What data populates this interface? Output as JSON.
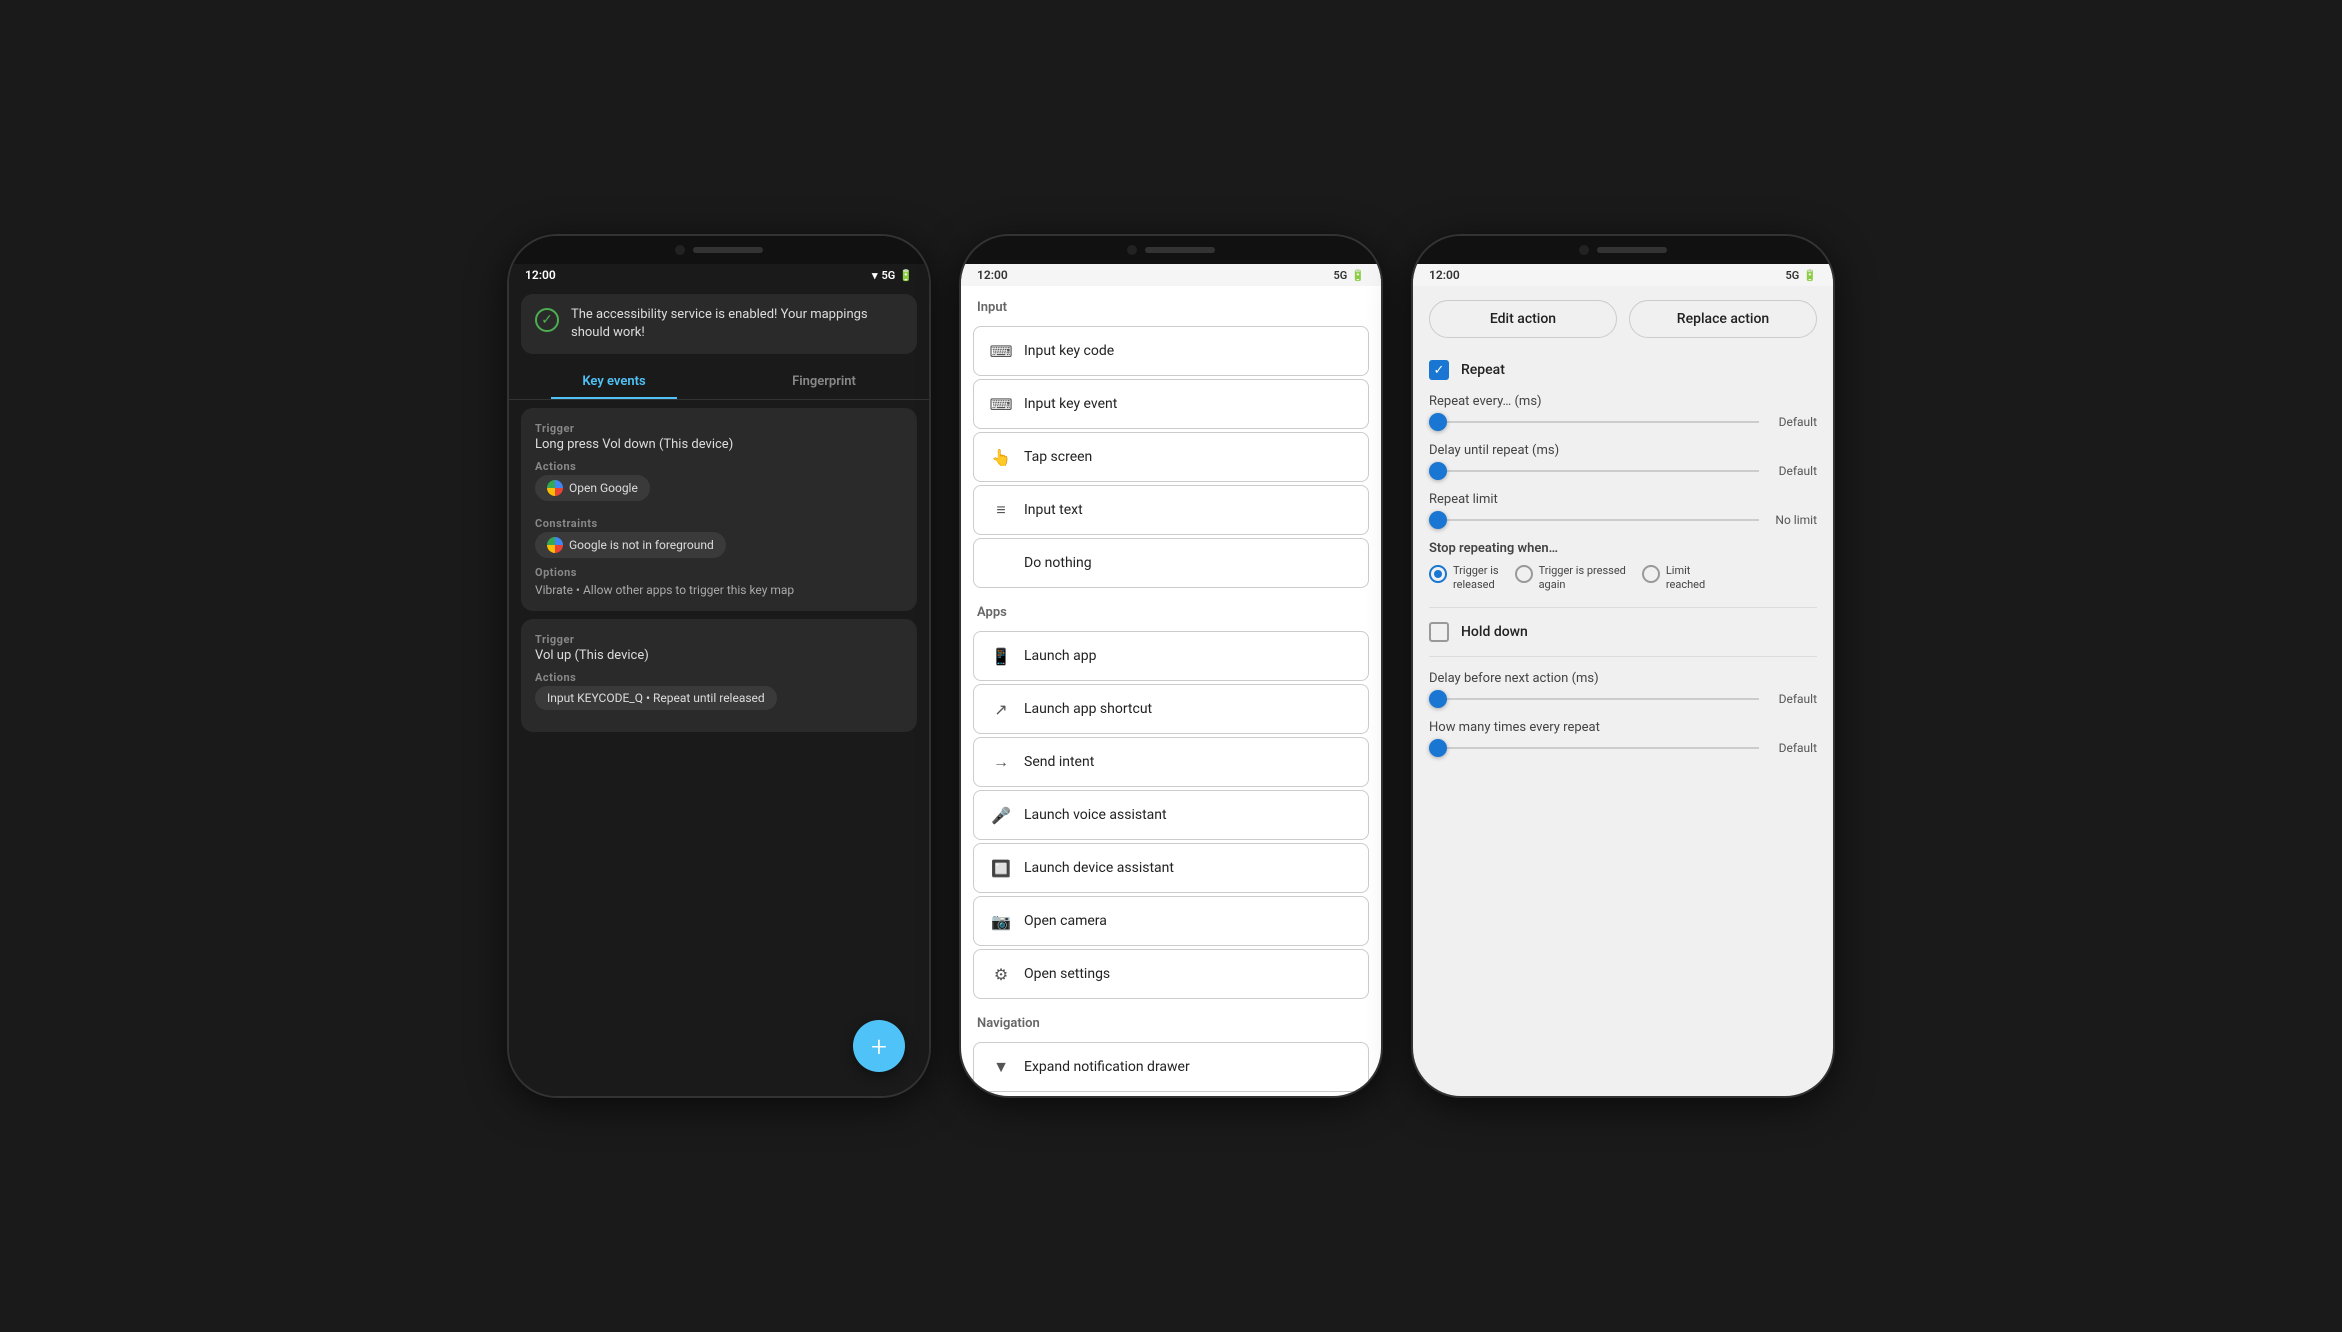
{
  "phone1": {
    "status": {
      "time": "12:00",
      "signal": "5G",
      "battery": "▐"
    },
    "notification": {
      "text": "The accessibility service is enabled! Your mappings should work!"
    },
    "tabs": [
      "Key events",
      "Fingerprint"
    ],
    "active_tab": 0,
    "mappings": [
      {
        "trigger_label": "Trigger",
        "trigger_value": "Long press Vol down (This device)",
        "actions_label": "Actions",
        "action_chip": "Open Google",
        "constraints_label": "Constraints",
        "constraint_chip": "Google is not in foreground",
        "options_label": "Options",
        "options_value": "Vibrate • Allow other apps to trigger this key map"
      },
      {
        "trigger_label": "Trigger",
        "trigger_value": "Vol up (This device)",
        "actions_label": "Actions",
        "action_chip": "Input KEYCODE_Q • Repeat until released",
        "constraints_label": null,
        "constraint_chip": null,
        "options_label": null,
        "options_value": null
      }
    ],
    "fab_label": "+"
  },
  "phone2": {
    "status": {
      "time": "12:00",
      "signal": "5G",
      "battery": "▐"
    },
    "section_input": "Input",
    "input_items": [
      {
        "icon": "⓪",
        "label": "Input key code"
      },
      {
        "icon": "⓪",
        "label": "Input key event"
      },
      {
        "icon": "✋",
        "label": "Tap screen"
      },
      {
        "icon": "≡",
        "label": "Input text"
      },
      {
        "icon": "",
        "label": "Do nothing"
      }
    ],
    "section_apps": "Apps",
    "app_items": [
      {
        "icon": "🤖",
        "label": "Launch app"
      },
      {
        "icon": "↗",
        "label": "Launch app shortcut"
      },
      {
        "icon": "→",
        "label": "Send intent"
      },
      {
        "icon": "⬆",
        "label": "Launch voice assistant"
      },
      {
        "icon": "⬆",
        "label": "Launch device assistant"
      },
      {
        "icon": "📷",
        "label": "Open camera"
      },
      {
        "icon": "⚙",
        "label": "Open settings"
      }
    ],
    "section_navigation": "Navigation",
    "nav_items": [
      {
        "icon": "▼",
        "label": "Expand notification drawer"
      }
    ]
  },
  "phone3": {
    "status": {
      "time": "12:00",
      "signal": "5G",
      "battery": "▐"
    },
    "edit_action_label": "Edit action",
    "replace_action_label": "Replace action",
    "repeat_label": "Repeat",
    "repeat_checked": true,
    "repeat_every_label": "Repeat every… (ms)",
    "repeat_every_value": "Default",
    "delay_until_label": "Delay until repeat (ms)",
    "delay_until_value": "Default",
    "repeat_limit_label": "Repeat limit",
    "repeat_limit_value": "No limit",
    "stop_repeating_label": "Stop repeating when…",
    "radio_options": [
      {
        "label": "Trigger is\nreleased",
        "selected": true
      },
      {
        "label": "Trigger is pressed\nagain",
        "selected": false
      },
      {
        "label": "Limit\nreached",
        "selected": false
      }
    ],
    "hold_down_label": "Hold down",
    "hold_down_checked": false,
    "delay_next_label": "Delay before next action (ms)",
    "delay_next_value": "Default",
    "how_many_label": "How many times every repeat",
    "how_many_value": "Default"
  }
}
